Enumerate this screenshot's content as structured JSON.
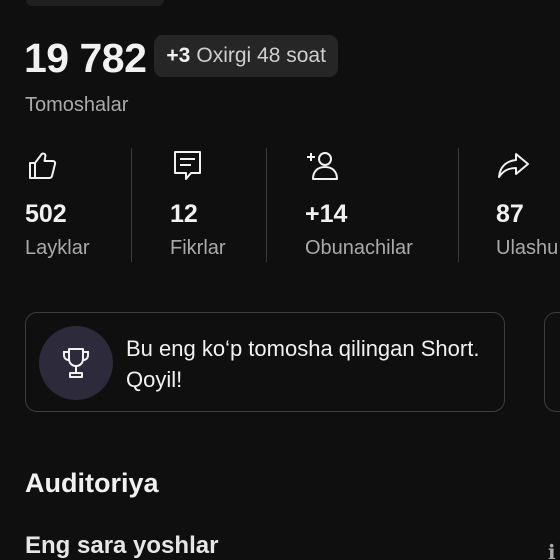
{
  "views": {
    "value": "19 782",
    "delta": "+3",
    "delta_period": "Oxirgi 48 soat",
    "label": "Tomoshalar"
  },
  "stats": [
    {
      "icon": "thumb-up-icon",
      "value": "502",
      "label": "Layklar"
    },
    {
      "icon": "comment-icon",
      "value": "12",
      "label": "Fikrlar"
    },
    {
      "icon": "add-subscriber-icon",
      "value": "+14",
      "label": "Obunachilar"
    },
    {
      "icon": "share-icon",
      "value": "87",
      "label": "Ulashu"
    }
  ],
  "banner": {
    "icon": "trophy-icon",
    "text": "Bu eng ko‘p tomosha qilingan Short. Qoyil!"
  },
  "audience": {
    "title": "Auditoriya",
    "subtitle": "Eng sara yoshlar"
  },
  "colors": {
    "background": "#0f0f0f",
    "text_primary": "#f1f1f1",
    "text_secondary": "#aaaaaa",
    "pill_background": "#262626",
    "trophy_circle": "#2d2a3b",
    "border": "#3d3d3d"
  }
}
